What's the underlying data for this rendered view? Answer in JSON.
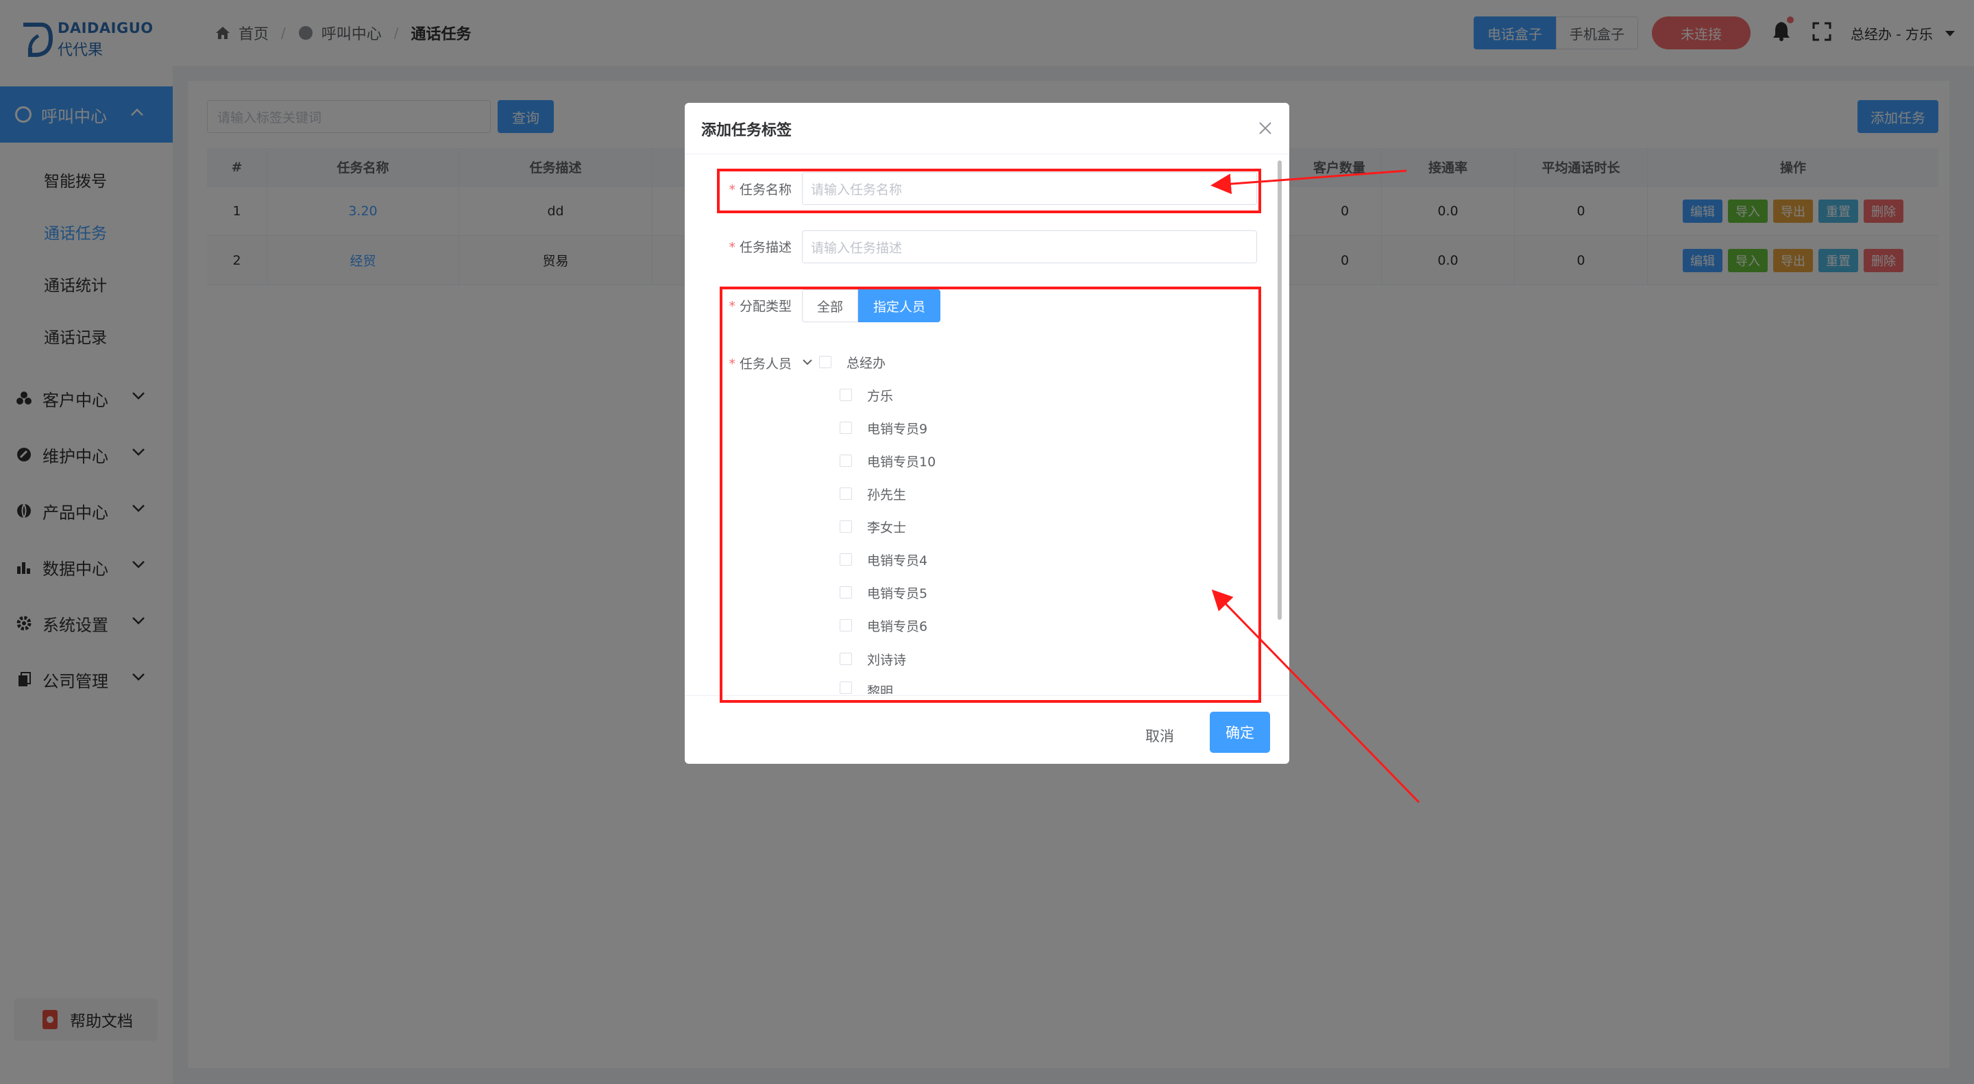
{
  "brand": {
    "name_en": "DAIDAIGUO",
    "name_cn": "代代果"
  },
  "sidebar": {
    "active_menu": "呼叫中心",
    "sub_items": [
      "智能拨号",
      "通话任务",
      "通话统计",
      "通话记录"
    ],
    "active_sub": "通话任务",
    "groups": [
      {
        "label": "客户中心",
        "icon": "customers-icon"
      },
      {
        "label": "维护中心",
        "icon": "maintenance-icon"
      },
      {
        "label": "产品中心",
        "icon": "product-icon"
      },
      {
        "label": "数据中心",
        "icon": "data-icon"
      },
      {
        "label": "系统设置",
        "icon": "gear-icon"
      },
      {
        "label": "公司管理",
        "icon": "company-icon"
      }
    ],
    "help": "帮助文档"
  },
  "header": {
    "breadcrumb": [
      "首页",
      "呼叫中心",
      "通话任务"
    ],
    "box_switch": [
      "电话盒子",
      "手机盒子"
    ],
    "connection": "未连接",
    "user": "总经办 - 方乐"
  },
  "toolbar": {
    "search_placeholder": "请输入标签关键词",
    "query": "查询",
    "add_task": "添加任务"
  },
  "table": {
    "headers": [
      "#",
      "任务名称",
      "任务描述",
      "客户数量",
      "接通率",
      "平均通话时长",
      "操作"
    ],
    "rows": [
      {
        "no": "1",
        "name": "3.20",
        "desc": "dd",
        "customers": "0",
        "rate": "0.0",
        "avg": "0"
      },
      {
        "no": "2",
        "name": "经贸",
        "desc": "贸易",
        "customers": "0",
        "rate": "0.0",
        "avg": "0"
      }
    ],
    "actions": [
      "编辑",
      "导入",
      "导出",
      "重置",
      "删除"
    ]
  },
  "dialog": {
    "title": "添加任务标签",
    "fields": {
      "name_label": "任务名称",
      "name_placeholder": "请输入任务名称",
      "desc_label": "任务描述",
      "desc_placeholder": "请输入任务描述",
      "assign_label": "分配类型",
      "assign_options": [
        "全部",
        "指定人员"
      ],
      "assign_selected": "指定人员",
      "members_label": "任务人员"
    },
    "tree": {
      "root": "总经办",
      "children": [
        "方乐",
        "电销专员9",
        "电销专员10",
        "孙先生",
        "李女士",
        "电销专员4",
        "电销专员5",
        "电销专员6",
        "刘诗诗",
        "黎明"
      ]
    },
    "cancel": "取消",
    "confirm": "确定"
  },
  "colors": {
    "primary": "#409eff",
    "danger": "#f56c6c",
    "annotation": "#ff1a1a"
  }
}
